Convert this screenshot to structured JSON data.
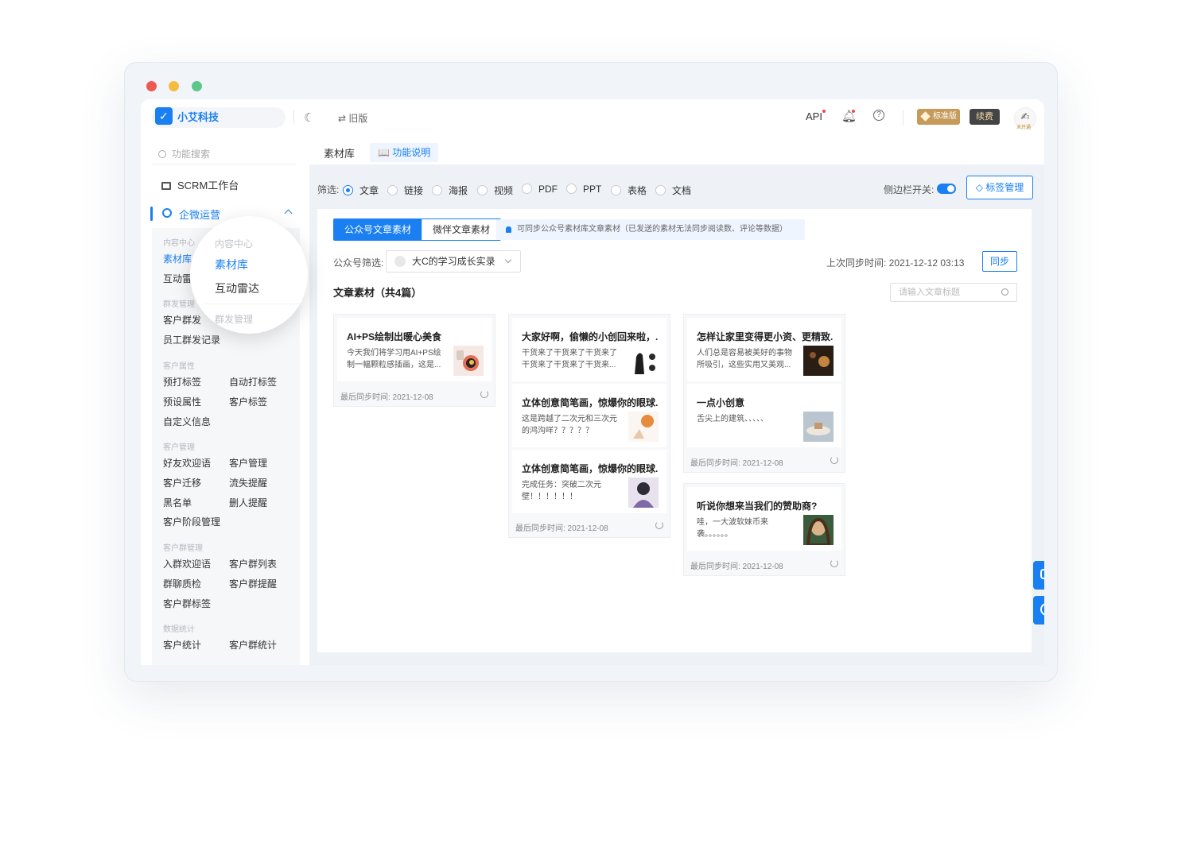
{
  "brand": {
    "name": "小艾科技",
    "mark": "✓"
  },
  "topbar": {
    "old_version": "⇄ 旧版",
    "api": "API",
    "help": "?",
    "edition": "标准版",
    "renew": "续费",
    "avatar_sub": "未开通"
  },
  "sidebar": {
    "search_placeholder": "功能搜索",
    "workbench": "SCRM工作台",
    "section": "企微运营",
    "groups": [
      {
        "title": "内容中心",
        "items": [
          "素材库",
          "互动雷达"
        ]
      },
      {
        "title": "群发管理",
        "items": [
          "客户群发",
          "员工群发记录"
        ]
      },
      {
        "title": "客户属性",
        "items": [
          "预打标签",
          "自动打标签",
          "预设属性",
          "客户标签",
          "自定义信息"
        ]
      },
      {
        "title": "客户管理",
        "items": [
          "好友欢迎语",
          "客户管理",
          "客户迁移",
          "流失提醒",
          "黑名单",
          "删人提醒",
          "客户阶段管理"
        ]
      },
      {
        "title": "客户群管理",
        "items": [
          "入群欢迎语",
          "客户群列表",
          "群聊质检",
          "客户群提醒",
          "客户群标签"
        ]
      },
      {
        "title": "数据统计",
        "items": [
          "客户统计",
          "客户群统计"
        ]
      }
    ]
  },
  "magnifier": {
    "group1": "内容中心",
    "item1": "素材库",
    "item2": "互动雷达",
    "group2": "群发管理"
  },
  "main": {
    "tab": "素材库",
    "help_tab": "📖 功能说明",
    "filter_label": "筛选:",
    "filters": [
      "文章",
      "链接",
      "海报",
      "视频",
      "PDF",
      "PPT",
      "表格",
      "文档"
    ],
    "selected_filter": "文章",
    "sidebar_switch_label": "侧边栏开关:",
    "tag_manage": "◇ 标签管理",
    "segments": [
      "公众号文章素材",
      "微伴文章素材"
    ],
    "notice": "可同步公众号素材库文章素材（已发送的素材无法同步阅读数、评论等数据）",
    "account_label": "公众号筛选:",
    "account_value": "大C的学习成长实录",
    "last_sync_label": "上次同步时间: 2021-12-12 03:13",
    "sync_button": "同步",
    "section_title": "文章素材（共4篇）",
    "search_placeholder": "请输入文章标题",
    "foot_label": "最后同步时间: 2021-12-08",
    "cards": [
      {
        "entries": [
          {
            "title": "AI+PS绘制出暖心美食",
            "desc": "今天我们将学习用AI+PS绘制一幅颗粒感插画，这是...",
            "thumb": "food"
          }
        ]
      },
      {
        "entries": [
          {
            "title": "大家好啊，偷懒的小创回来啦，...",
            "desc": "干货来了干货来了干货来了干货来了干货来了干货来...",
            "thumb": "figure"
          },
          {
            "title": "立体创意简笔画，惊爆你的眼球...",
            "desc": "这是跨越了二次元和三次元的鸿沟咩？？？？？",
            "thumb": "ball"
          },
          {
            "title": "立体创意简笔画，惊爆你的眼球...",
            "desc": "完成任务：突破二次元壁！！！！！！",
            "thumb": "girl"
          }
        ]
      },
      {
        "entries": [
          {
            "title": "怎样让家里变得更小资、更精致...",
            "desc": "人们总是容易被美好的事物所吸引，这些实用又美观...",
            "thumb": "lamp"
          },
          {
            "title": "一点小创意",
            "desc": "舌尖上的建筑、、、、、",
            "thumb": "plate"
          }
        ]
      },
      {
        "entries": [
          {
            "title": "听说你想来当我们的赞助商?",
            "desc": "哇，一大波软妹币来袭。。。。。。",
            "thumb": "face"
          }
        ]
      }
    ]
  },
  "colors": {
    "accent": "#1a7ff0",
    "traffic": [
      "#ee5a4f",
      "#f5bd3f",
      "#5bc88a"
    ]
  }
}
